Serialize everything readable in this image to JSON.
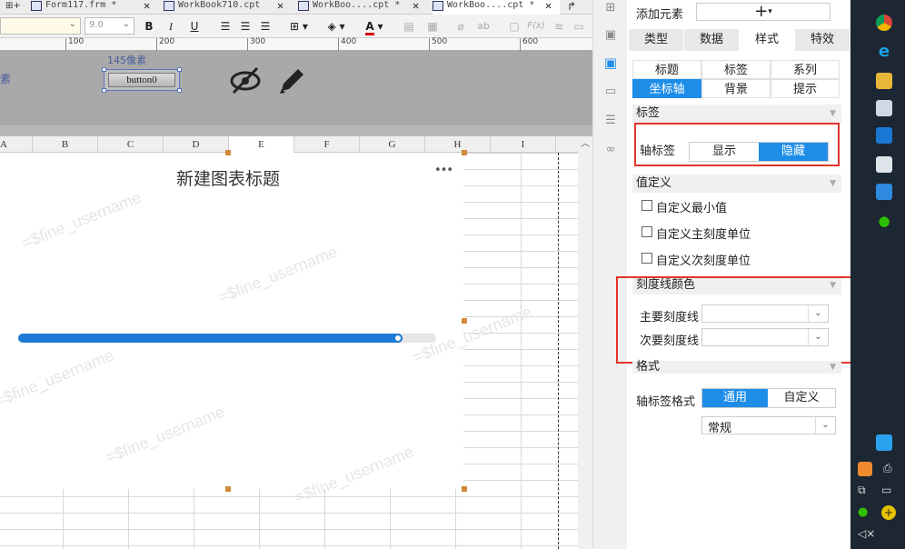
{
  "tabs": [
    {
      "label": "Form117.frm *"
    },
    {
      "label": "WorkBook710.cpt"
    },
    {
      "label": "WorkBoo....cpt *"
    },
    {
      "label": "WorkBoo....cpt *"
    }
  ],
  "toolbar": {
    "font_size": "9.0",
    "bold": "B",
    "italic": "I",
    "underline": "U",
    "font_color": "A",
    "ab": "ab",
    "fx": "F(x)"
  },
  "ruler": [
    "100",
    "200",
    "300",
    "400",
    "500",
    "600"
  ],
  "formarea": {
    "partial_label": "素",
    "size_label": "145像素",
    "button_label": "button0"
  },
  "columns": [
    "A",
    "B",
    "C",
    "D",
    "E",
    "F",
    "G",
    "H",
    "I"
  ],
  "chart": {
    "title": "新建图表标题",
    "more": "•••",
    "watermark": "=$fine_username",
    "progress": 0.92,
    "bar_color": "#1f7ad6"
  },
  "panel": {
    "add_element_label": "添加元素",
    "add_symbol": "+",
    "main_tabs": [
      "类型",
      "数据",
      "样式",
      "特效"
    ],
    "active_main_tab": "样式",
    "sub_tabs_row1": [
      "标题",
      "标签",
      "系列"
    ],
    "sub_tabs_row2": [
      "坐标轴",
      "背景",
      "提示"
    ],
    "active_sub_tab": "坐标轴",
    "label_section": "标签",
    "axis_label": "轴标签",
    "axis_label_options": [
      "显示",
      "隐藏"
    ],
    "axis_label_selected": "隐藏",
    "value_def_section": "值定义",
    "checkboxes": [
      "自定义最小值",
      "自定义主刻度单位",
      "自定义次刻度单位"
    ],
    "tick_color_section": "刻度线颜色",
    "major_tick": "主要刻度线",
    "minor_tick": "次要刻度线",
    "format_section": "格式",
    "axis_label_format": "轴标签格式",
    "format_options": [
      "通用",
      "自定义"
    ],
    "format_selected": "通用",
    "format_value": "常规",
    "accent": "#1e8de8",
    "highlight": "#e0342c"
  }
}
